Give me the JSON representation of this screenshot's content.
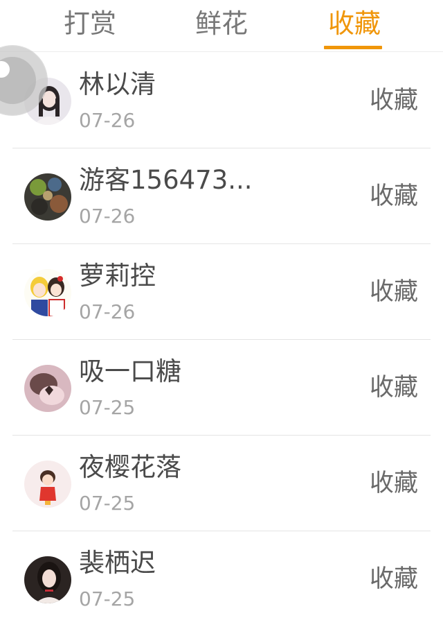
{
  "tabs": [
    {
      "label": "打赏",
      "active": false
    },
    {
      "label": "鲜花",
      "active": false
    },
    {
      "label": "收藏",
      "active": true
    }
  ],
  "accent_color": "#f0960a",
  "action_label": "收藏",
  "items": [
    {
      "name": "林以清",
      "date": "07-26",
      "action": "收藏",
      "avatar_icon": "girl-portrait-avatar-icon"
    },
    {
      "name": "游客156473...",
      "date": "07-26",
      "action": "收藏",
      "avatar_icon": "blurry-photo-avatar-icon"
    },
    {
      "name": "萝莉控",
      "date": "07-26",
      "action": "收藏",
      "avatar_icon": "anime-girls-avatar-icon"
    },
    {
      "name": "吸一口糖",
      "date": "07-25",
      "action": "收藏",
      "avatar_icon": "pink-photo-avatar-icon"
    },
    {
      "name": "夜樱花落",
      "date": "07-25",
      "action": "收藏",
      "avatar_icon": "cartoon-child-avatar-icon"
    },
    {
      "name": "裴栖迟",
      "date": "07-25",
      "action": "收藏",
      "avatar_icon": "dark-hair-girl-avatar-icon"
    }
  ]
}
